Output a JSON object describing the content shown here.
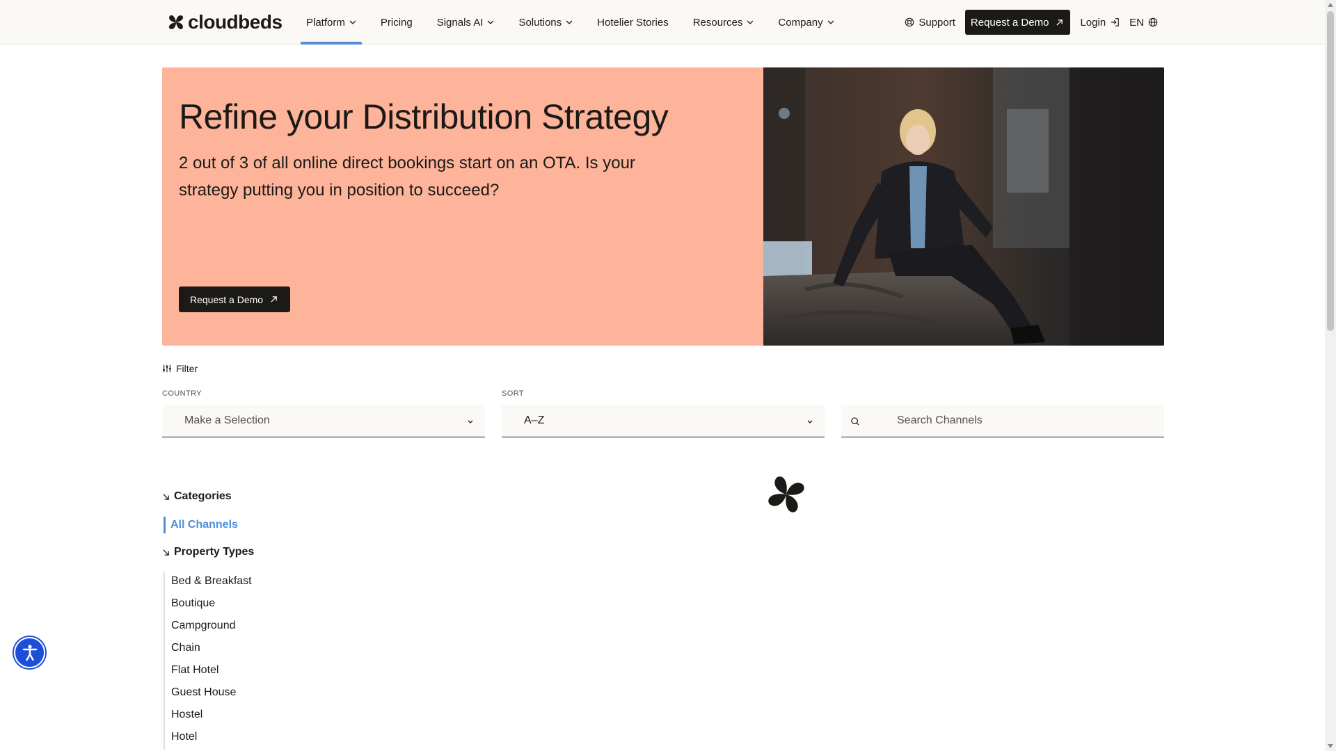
{
  "brand": {
    "name": "cloudbeds"
  },
  "nav": {
    "items": [
      {
        "label": "Platform",
        "has_dropdown": true,
        "active": true
      },
      {
        "label": "Pricing",
        "has_dropdown": false
      },
      {
        "label": "Signals AI",
        "has_dropdown": true
      },
      {
        "label": "Solutions",
        "has_dropdown": true
      },
      {
        "label": "Hotelier Stories",
        "has_dropdown": false
      },
      {
        "label": "Resources",
        "has_dropdown": true
      },
      {
        "label": "Company",
        "has_dropdown": true
      }
    ],
    "support": "Support",
    "cta": "Request a Demo",
    "login": "Login",
    "lang": "EN"
  },
  "hero": {
    "title": "Refine your Distribution Strategy",
    "subtitle": "2 out of 3 of all online direct bookings start on an OTA. Is your strategy putting you in position to succeed?",
    "cta": "Request a Demo"
  },
  "filters": {
    "filter_label": "Filter",
    "country_label": "COUNTRY",
    "country_value": "Make a Selection",
    "sort_label": "SORT",
    "sort_value": "A–Z",
    "search_placeholder": "Search Channels"
  },
  "sidebar": {
    "categories_heading": "Categories",
    "all_channels": "All Channels",
    "property_types_heading": "Property Types",
    "property_types": [
      "Bed & Breakfast",
      "Boutique",
      "Campground",
      "Chain",
      "Flat Hotel",
      "Guest House",
      "Hostel",
      "Hotel"
    ]
  },
  "colors": {
    "hero_bg": "#fdb49a",
    "accent": "#4f8fd8",
    "dark": "#1c1a17",
    "a11y": "#1d4ed8"
  }
}
